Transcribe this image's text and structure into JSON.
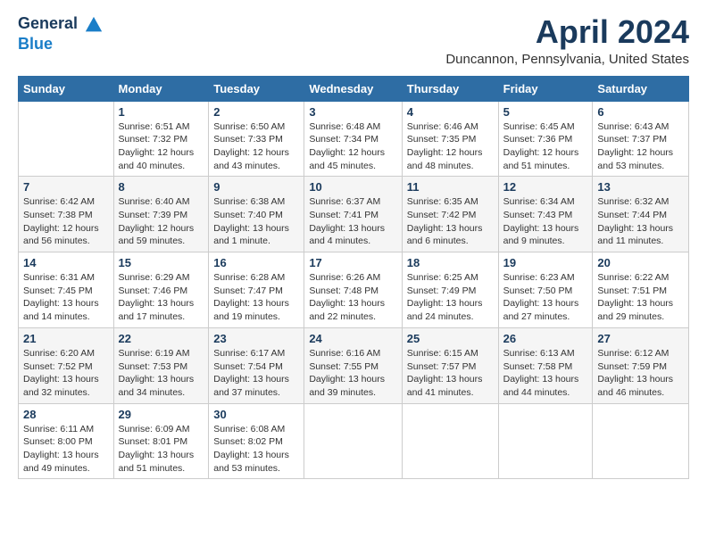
{
  "header": {
    "logo_general": "General",
    "logo_blue": "Blue",
    "month_title": "April 2024",
    "location": "Duncannon, Pennsylvania, United States"
  },
  "columns": [
    "Sunday",
    "Monday",
    "Tuesday",
    "Wednesday",
    "Thursday",
    "Friday",
    "Saturday"
  ],
  "weeks": [
    [
      {
        "day": "",
        "info": ""
      },
      {
        "day": "1",
        "info": "Sunrise: 6:51 AM\nSunset: 7:32 PM\nDaylight: 12 hours\nand 40 minutes."
      },
      {
        "day": "2",
        "info": "Sunrise: 6:50 AM\nSunset: 7:33 PM\nDaylight: 12 hours\nand 43 minutes."
      },
      {
        "day": "3",
        "info": "Sunrise: 6:48 AM\nSunset: 7:34 PM\nDaylight: 12 hours\nand 45 minutes."
      },
      {
        "day": "4",
        "info": "Sunrise: 6:46 AM\nSunset: 7:35 PM\nDaylight: 12 hours\nand 48 minutes."
      },
      {
        "day": "5",
        "info": "Sunrise: 6:45 AM\nSunset: 7:36 PM\nDaylight: 12 hours\nand 51 minutes."
      },
      {
        "day": "6",
        "info": "Sunrise: 6:43 AM\nSunset: 7:37 PM\nDaylight: 12 hours\nand 53 minutes."
      }
    ],
    [
      {
        "day": "7",
        "info": "Sunrise: 6:42 AM\nSunset: 7:38 PM\nDaylight: 12 hours\nand 56 minutes."
      },
      {
        "day": "8",
        "info": "Sunrise: 6:40 AM\nSunset: 7:39 PM\nDaylight: 12 hours\nand 59 minutes."
      },
      {
        "day": "9",
        "info": "Sunrise: 6:38 AM\nSunset: 7:40 PM\nDaylight: 13 hours\nand 1 minute."
      },
      {
        "day": "10",
        "info": "Sunrise: 6:37 AM\nSunset: 7:41 PM\nDaylight: 13 hours\nand 4 minutes."
      },
      {
        "day": "11",
        "info": "Sunrise: 6:35 AM\nSunset: 7:42 PM\nDaylight: 13 hours\nand 6 minutes."
      },
      {
        "day": "12",
        "info": "Sunrise: 6:34 AM\nSunset: 7:43 PM\nDaylight: 13 hours\nand 9 minutes."
      },
      {
        "day": "13",
        "info": "Sunrise: 6:32 AM\nSunset: 7:44 PM\nDaylight: 13 hours\nand 11 minutes."
      }
    ],
    [
      {
        "day": "14",
        "info": "Sunrise: 6:31 AM\nSunset: 7:45 PM\nDaylight: 13 hours\nand 14 minutes."
      },
      {
        "day": "15",
        "info": "Sunrise: 6:29 AM\nSunset: 7:46 PM\nDaylight: 13 hours\nand 17 minutes."
      },
      {
        "day": "16",
        "info": "Sunrise: 6:28 AM\nSunset: 7:47 PM\nDaylight: 13 hours\nand 19 minutes."
      },
      {
        "day": "17",
        "info": "Sunrise: 6:26 AM\nSunset: 7:48 PM\nDaylight: 13 hours\nand 22 minutes."
      },
      {
        "day": "18",
        "info": "Sunrise: 6:25 AM\nSunset: 7:49 PM\nDaylight: 13 hours\nand 24 minutes."
      },
      {
        "day": "19",
        "info": "Sunrise: 6:23 AM\nSunset: 7:50 PM\nDaylight: 13 hours\nand 27 minutes."
      },
      {
        "day": "20",
        "info": "Sunrise: 6:22 AM\nSunset: 7:51 PM\nDaylight: 13 hours\nand 29 minutes."
      }
    ],
    [
      {
        "day": "21",
        "info": "Sunrise: 6:20 AM\nSunset: 7:52 PM\nDaylight: 13 hours\nand 32 minutes."
      },
      {
        "day": "22",
        "info": "Sunrise: 6:19 AM\nSunset: 7:53 PM\nDaylight: 13 hours\nand 34 minutes."
      },
      {
        "day": "23",
        "info": "Sunrise: 6:17 AM\nSunset: 7:54 PM\nDaylight: 13 hours\nand 37 minutes."
      },
      {
        "day": "24",
        "info": "Sunrise: 6:16 AM\nSunset: 7:55 PM\nDaylight: 13 hours\nand 39 minutes."
      },
      {
        "day": "25",
        "info": "Sunrise: 6:15 AM\nSunset: 7:57 PM\nDaylight: 13 hours\nand 41 minutes."
      },
      {
        "day": "26",
        "info": "Sunrise: 6:13 AM\nSunset: 7:58 PM\nDaylight: 13 hours\nand 44 minutes."
      },
      {
        "day": "27",
        "info": "Sunrise: 6:12 AM\nSunset: 7:59 PM\nDaylight: 13 hours\nand 46 minutes."
      }
    ],
    [
      {
        "day": "28",
        "info": "Sunrise: 6:11 AM\nSunset: 8:00 PM\nDaylight: 13 hours\nand 49 minutes."
      },
      {
        "day": "29",
        "info": "Sunrise: 6:09 AM\nSunset: 8:01 PM\nDaylight: 13 hours\nand 51 minutes."
      },
      {
        "day": "30",
        "info": "Sunrise: 6:08 AM\nSunset: 8:02 PM\nDaylight: 13 hours\nand 53 minutes."
      },
      {
        "day": "",
        "info": ""
      },
      {
        "day": "",
        "info": ""
      },
      {
        "day": "",
        "info": ""
      },
      {
        "day": "",
        "info": ""
      }
    ]
  ]
}
